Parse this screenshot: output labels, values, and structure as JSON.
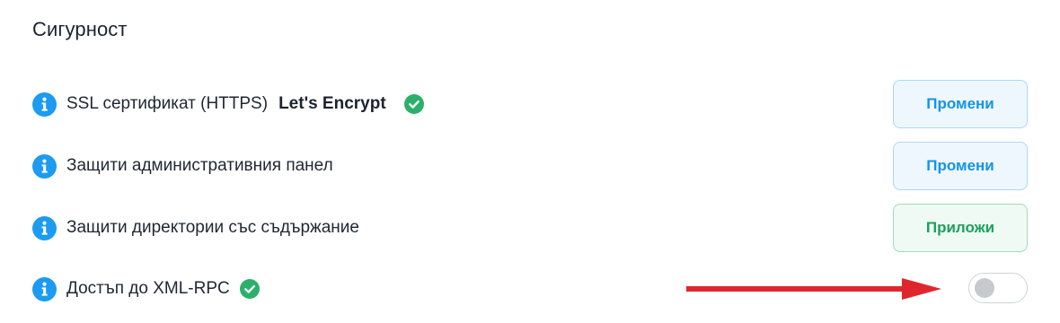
{
  "section": {
    "title": "Сигурност"
  },
  "rows": [
    {
      "label": "SSL сертификат (HTTPS)",
      "value": "Let's Encrypt",
      "status_icon": "check-circle-icon",
      "button_label": "Промени"
    },
    {
      "label": "Защити административния панел",
      "button_label": "Промени"
    },
    {
      "label": "Защити директории със съдържание",
      "button_label": "Приложи"
    },
    {
      "label": "Достъп до XML-RPC",
      "status_icon": "check-circle-icon",
      "toggle_on": false
    }
  ],
  "icons": {
    "info": "info-icon",
    "check": "check-circle-icon",
    "annotation": "red-arrow-icon"
  },
  "colors": {
    "info_blue": "#1c9bf0",
    "check_green": "#2bb06c",
    "button_blue_text": "#1593e8",
    "button_blue_bg": "#eef7fe",
    "button_green_text": "#1e9f5e",
    "button_green_bg": "#eefaf3",
    "annotation_arrow": "#e0262d"
  }
}
